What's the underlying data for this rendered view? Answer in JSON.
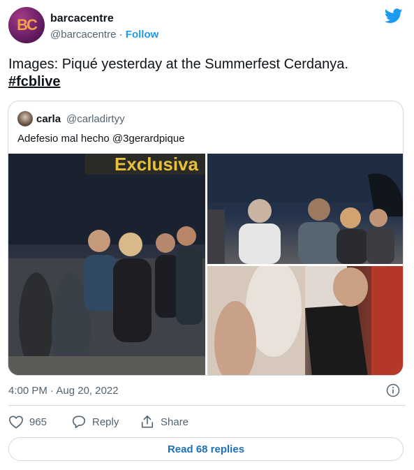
{
  "author": {
    "avatar_text": "BC",
    "name": "barcacentre",
    "handle": "@barcacentre",
    "separator": " · ",
    "follow_label": "Follow"
  },
  "tweet": {
    "text": "Images: Piqué yesterday at the Summerfest Cerdanya.",
    "hashtag": "#fcblive"
  },
  "quote": {
    "name": "carla",
    "handle": "@carladirtyy",
    "text": "Adefesio mal hecho @3gerardpique",
    "image_caption_text": "Exclusiva"
  },
  "meta": {
    "timestamp": "4:00 PM · Aug 20, 2022"
  },
  "actions": {
    "like_count": "965",
    "reply_label": "Reply",
    "share_label": "Share"
  },
  "read_replies_label": "Read 68 replies",
  "colors": {
    "accent": "#1d9bf0",
    "muted": "#536471",
    "border": "#cfd9de",
    "link": "#1d6fb8"
  },
  "icons": [
    "twitter-bird-icon",
    "info-icon",
    "heart-icon",
    "reply-icon",
    "share-icon"
  ]
}
